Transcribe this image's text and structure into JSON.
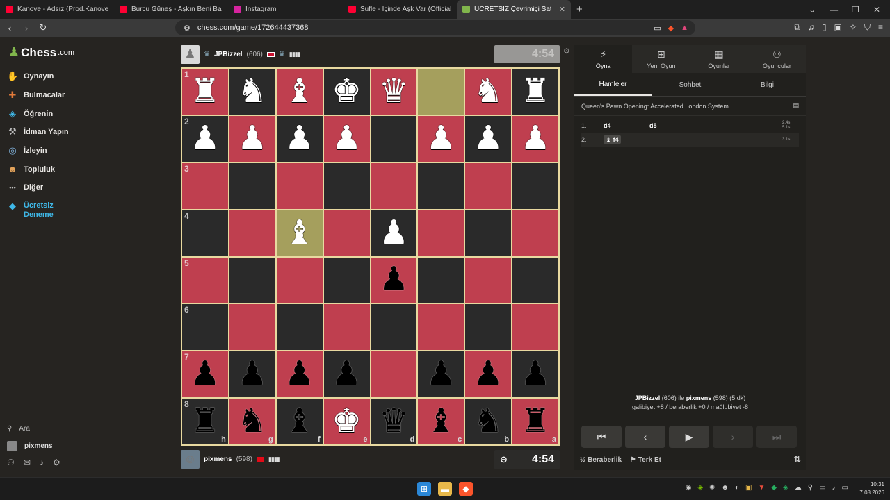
{
  "browser": {
    "tabs": [
      {
        "label": "Kanove - Adsız (Prod.Kanove) - YouTu",
        "color": "#ff0033"
      },
      {
        "label": "Burcu Güneş - Aşkın Beni Baştan Yaz",
        "color": "#ff0033"
      },
      {
        "label": "Instagram",
        "color": "#d6249f"
      },
      {
        "label": "Sufle - İçinde Aşk Var (Official Au",
        "color": "#ff0033"
      },
      {
        "label": "ÜCRETSİZ Çevrimiçi Satranç (",
        "color": "#81b64c"
      }
    ],
    "url": "chess.com/game/172644437368"
  },
  "sidebar": {
    "logo_text": "Chess",
    "logo_suffix": ".com",
    "items": [
      {
        "label": "Oynayın",
        "icon": "play-hand-icon"
      },
      {
        "label": "Bulmacalar",
        "icon": "puzzle-icon"
      },
      {
        "label": "Öğrenin",
        "icon": "graduation-cap-icon"
      },
      {
        "label": "İdman Yapın",
        "icon": "dumbbell-icon"
      },
      {
        "label": "İzleyin",
        "icon": "binoculars-icon"
      },
      {
        "label": "Topluluk",
        "icon": "community-icon"
      },
      {
        "label": "Diğer",
        "icon": "more-dots-icon"
      }
    ],
    "trial_line1": "Ücretsiz",
    "trial_line2": "Deneme",
    "search_label": "Ara",
    "user_label": "pixmens"
  },
  "top_player": {
    "name": "JPBizzel",
    "rating": "(606)",
    "clock": "4:54"
  },
  "bottom_player": {
    "name": "pixmens",
    "rating": "(598)",
    "clock": "4:54"
  },
  "board": {
    "rows": [
      {
        "rank": "1",
        "cells": [
          "♜",
          "♞",
          "♝",
          "♚",
          "♛",
          "",
          "♞",
          "♜"
        ],
        "color": [
          "w",
          "w",
          "w",
          "w",
          "w",
          "",
          "w",
          "w"
        ]
      },
      {
        "rank": "2",
        "cells": [
          "♟",
          "♟",
          "♟",
          "♟",
          "",
          "♟",
          "♟",
          "♟"
        ],
        "color": [
          "w",
          "w",
          "w",
          "w",
          "",
          "w",
          "w",
          "w"
        ]
      },
      {
        "rank": "3",
        "cells": [
          "",
          "",
          "",
          "",
          "",
          "",
          "",
          ""
        ],
        "color": [
          "",
          "",
          "",
          "",
          "",
          "",
          "",
          ""
        ]
      },
      {
        "rank": "4",
        "cells": [
          "",
          "",
          "♝",
          "",
          "♟",
          "",
          "",
          ""
        ],
        "color": [
          "",
          "",
          "w",
          "",
          "w",
          "",
          "",
          ""
        ]
      },
      {
        "rank": "5",
        "cells": [
          "",
          "",
          "",
          "",
          "♟",
          "",
          "",
          ""
        ],
        "color": [
          "",
          "",
          "",
          "",
          "b",
          "",
          "",
          ""
        ]
      },
      {
        "rank": "6",
        "cells": [
          "",
          "",
          "",
          "",
          "",
          "",
          "",
          ""
        ],
        "color": [
          "",
          "",
          "",
          "",
          "",
          "",
          "",
          ""
        ]
      },
      {
        "rank": "7",
        "cells": [
          "♟",
          "♟",
          "♟",
          "♟",
          "",
          "♟",
          "♟",
          "♟"
        ],
        "color": [
          "b",
          "b",
          "b",
          "b",
          "",
          "b",
          "b",
          "b"
        ]
      },
      {
        "rank": "8",
        "cells": [
          "♜",
          "♞",
          "♝",
          "♚",
          "♛",
          "♝",
          "♞",
          "♜"
        ],
        "color": [
          "b",
          "b",
          "b",
          "w",
          "b",
          "b",
          "b",
          "b"
        ]
      }
    ],
    "files": [
      "h",
      "g",
      "f",
      "e",
      "d",
      "c",
      "b",
      "a"
    ],
    "highlight": [
      [
        0,
        5
      ],
      [
        3,
        2
      ]
    ]
  },
  "right_panel": {
    "tabs": [
      {
        "label": "Oyna",
        "icon": "lightning-icon"
      },
      {
        "label": "Yeni Oyun",
        "icon": "plus-square-icon"
      },
      {
        "label": "Oyunlar",
        "icon": "board-icon"
      },
      {
        "label": "Oyuncular",
        "icon": "players-icon"
      }
    ],
    "subtabs": [
      "Hamleler",
      "Sohbet",
      "Bilgi"
    ],
    "opening": "Queen's Pawn Opening: Accelerated London System",
    "moves": [
      {
        "num": "1.",
        "white": "d4",
        "black": "d5",
        "t1": "2.4s",
        "t2": "5.1s"
      },
      {
        "num": "2.",
        "white": "f4",
        "black": "",
        "t1": "3.1s",
        "t2": ""
      }
    ],
    "game_info_p1": "JPBizzel",
    "game_info_mid1": "(606) ile",
    "game_info_p2": "pixmens",
    "game_info_mid2": "(598) (5 dk)",
    "game_info_line2": "galibiyet +8 / beraberlik +0 / mağlubiyet -8",
    "draw_label": "Beraberlik",
    "resign_label": "Terk Et"
  },
  "taskbar": {
    "time": "10:31",
    "date": "7.08.2026"
  }
}
